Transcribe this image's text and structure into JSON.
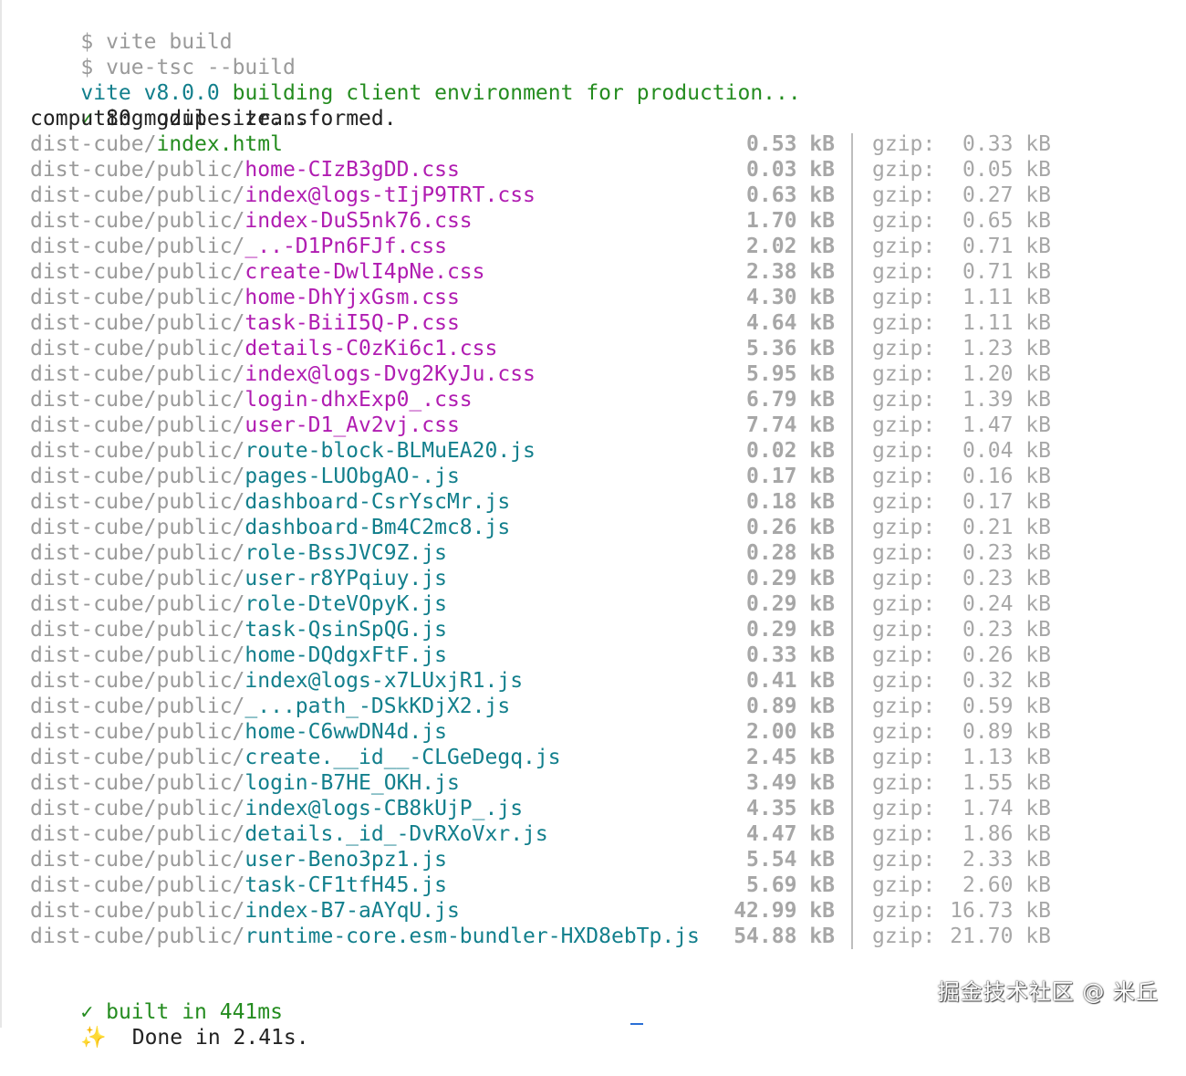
{
  "commands": [
    {
      "prompt": "$",
      "text": "vite build"
    },
    {
      "prompt": "$",
      "text": "vue-tsc --build"
    }
  ],
  "banner": {
    "tool": "vite",
    "version": "v8.0.0",
    "message": "building client environment for production..."
  },
  "transform": {
    "check": "✓",
    "text": "80 modules transformed."
  },
  "gzip_status": "computing gzip size...",
  "files": [
    {
      "dir": "dist-cube/",
      "name": "index.html",
      "type": "html",
      "size": "0.53",
      "gzip": "0.33"
    },
    {
      "dir": "dist-cube/public/",
      "name": "home-CIzB3gDD.css",
      "type": "css",
      "size": "0.03",
      "gzip": "0.05"
    },
    {
      "dir": "dist-cube/public/",
      "name": "index@logs-tIjP9TRT.css",
      "type": "css",
      "size": "0.63",
      "gzip": "0.27"
    },
    {
      "dir": "dist-cube/public/",
      "name": "index-DuS5nk76.css",
      "type": "css",
      "size": "1.70",
      "gzip": "0.65"
    },
    {
      "dir": "dist-cube/public/",
      "name": "_..-D1Pn6FJf.css",
      "type": "css",
      "size": "2.02",
      "gzip": "0.71"
    },
    {
      "dir": "dist-cube/public/",
      "name": "create-DwlI4pNe.css",
      "type": "css",
      "size": "2.38",
      "gzip": "0.71"
    },
    {
      "dir": "dist-cube/public/",
      "name": "home-DhYjxGsm.css",
      "type": "css",
      "size": "4.30",
      "gzip": "1.11"
    },
    {
      "dir": "dist-cube/public/",
      "name": "task-BiiI5Q-P.css",
      "type": "css",
      "size": "4.64",
      "gzip": "1.11"
    },
    {
      "dir": "dist-cube/public/",
      "name": "details-C0zKi6c1.css",
      "type": "css",
      "size": "5.36",
      "gzip": "1.23"
    },
    {
      "dir": "dist-cube/public/",
      "name": "index@logs-Dvg2KyJu.css",
      "type": "css",
      "size": "5.95",
      "gzip": "1.20"
    },
    {
      "dir": "dist-cube/public/",
      "name": "login-dhxExp0_.css",
      "type": "css",
      "size": "6.79",
      "gzip": "1.39"
    },
    {
      "dir": "dist-cube/public/",
      "name": "user-D1_Av2vj.css",
      "type": "css",
      "size": "7.74",
      "gzip": "1.47"
    },
    {
      "dir": "dist-cube/public/",
      "name": "route-block-BLMuEA20.js",
      "type": "js",
      "size": "0.02",
      "gzip": "0.04"
    },
    {
      "dir": "dist-cube/public/",
      "name": "pages-LUObgAO-.js",
      "type": "js",
      "size": "0.17",
      "gzip": "0.16"
    },
    {
      "dir": "dist-cube/public/",
      "name": "dashboard-CsrYscMr.js",
      "type": "js",
      "size": "0.18",
      "gzip": "0.17"
    },
    {
      "dir": "dist-cube/public/",
      "name": "dashboard-Bm4C2mc8.js",
      "type": "js",
      "size": "0.26",
      "gzip": "0.21"
    },
    {
      "dir": "dist-cube/public/",
      "name": "role-BssJVC9Z.js",
      "type": "js",
      "size": "0.28",
      "gzip": "0.23"
    },
    {
      "dir": "dist-cube/public/",
      "name": "user-r8YPqiuy.js",
      "type": "js",
      "size": "0.29",
      "gzip": "0.23"
    },
    {
      "dir": "dist-cube/public/",
      "name": "role-DteVOpyK.js",
      "type": "js",
      "size": "0.29",
      "gzip": "0.24"
    },
    {
      "dir": "dist-cube/public/",
      "name": "task-QsinSpQG.js",
      "type": "js",
      "size": "0.29",
      "gzip": "0.23"
    },
    {
      "dir": "dist-cube/public/",
      "name": "home-DQdgxFtF.js",
      "type": "js",
      "size": "0.33",
      "gzip": "0.26"
    },
    {
      "dir": "dist-cube/public/",
      "name": "index@logs-x7LUxjR1.js",
      "type": "js",
      "size": "0.41",
      "gzip": "0.32"
    },
    {
      "dir": "dist-cube/public/",
      "name": "_...path_-DSkKDjX2.js",
      "type": "js",
      "size": "0.89",
      "gzip": "0.59"
    },
    {
      "dir": "dist-cube/public/",
      "name": "home-C6wwDN4d.js",
      "type": "js",
      "size": "2.00",
      "gzip": "0.89"
    },
    {
      "dir": "dist-cube/public/",
      "name": "create.__id__-CLGeDegq.js",
      "type": "js",
      "size": "2.45",
      "gzip": "1.13"
    },
    {
      "dir": "dist-cube/public/",
      "name": "login-B7HE_OKH.js",
      "type": "js",
      "size": "3.49",
      "gzip": "1.55"
    },
    {
      "dir": "dist-cube/public/",
      "name": "index@logs-CB8kUjP_.js",
      "type": "js",
      "size": "4.35",
      "gzip": "1.74"
    },
    {
      "dir": "dist-cube/public/",
      "name": "details._id_-DvRXoVxr.js",
      "type": "js",
      "size": "4.47",
      "gzip": "1.86"
    },
    {
      "dir": "dist-cube/public/",
      "name": "user-Beno3pz1.js",
      "type": "js",
      "size": "5.54",
      "gzip": "2.33"
    },
    {
      "dir": "dist-cube/public/",
      "name": "task-CF1tfH45.js",
      "type": "js",
      "size": "5.69",
      "gzip": "2.60"
    },
    {
      "dir": "dist-cube/public/",
      "name": "index-B7-aAYqU.js",
      "type": "js",
      "size": "42.99",
      "gzip": "16.73"
    },
    {
      "dir": "dist-cube/public/",
      "name": "runtime-core.esm-bundler-HXD8ebTp.js",
      "type": "js",
      "size": "54.88",
      "gzip": "21.70"
    }
  ],
  "unit": "kB",
  "gzip_label": "gzip:",
  "built": {
    "check": "✓",
    "text": "built in 441ms"
  },
  "done": {
    "icon": "✨",
    "text": "Done in 2.41s."
  },
  "watermark": "掘金技术社区 @ 米丘",
  "colors": {
    "cyan": "#127f8c",
    "green": "#248c1f",
    "magenta": "#b01cb1",
    "dim": "#9a9a9a"
  }
}
